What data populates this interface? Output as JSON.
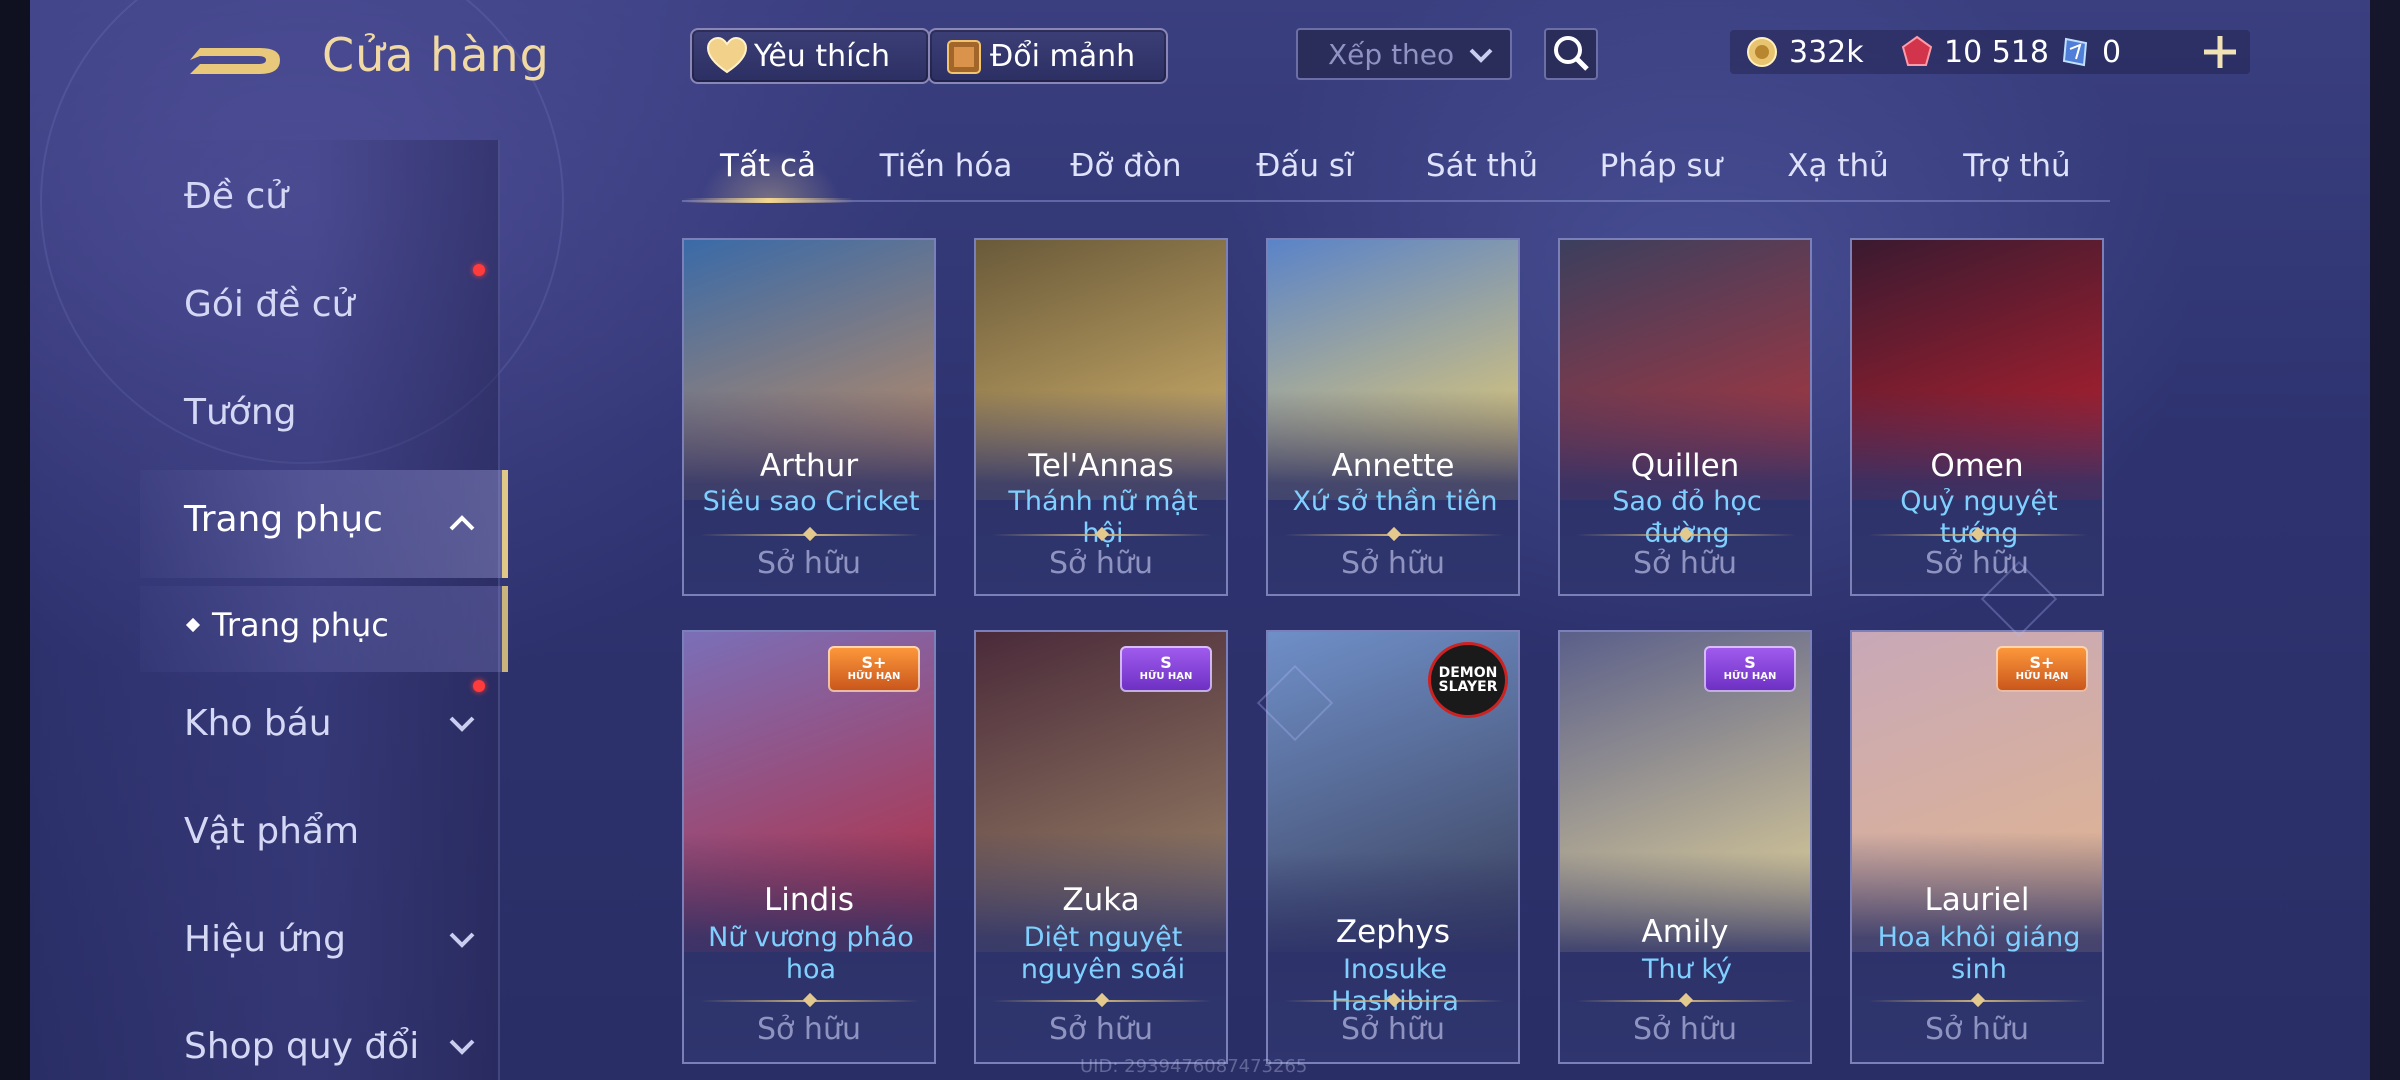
{
  "header": {
    "title": "Cửa hàng",
    "favorites_label": "Yêu thích",
    "shard_exchange_label": "Đổi mảnh",
    "sort_placeholder": "Xếp theo",
    "currencies": [
      {
        "icon": "gold-coin-icon",
        "value": "332k"
      },
      {
        "icon": "red-gem-icon",
        "value": "10 518"
      },
      {
        "icon": "card-voucher-icon",
        "value": "0"
      }
    ]
  },
  "sidebar": {
    "items": [
      {
        "label": "Đề cử"
      },
      {
        "label": "Gói đề cử"
      },
      {
        "label": "Tướng"
      },
      {
        "label": "Trang phục"
      },
      {
        "label": "Trang phục"
      },
      {
        "label": "Kho báu"
      },
      {
        "label": "Vật phẩm"
      },
      {
        "label": "Hiệu ứng"
      },
      {
        "label": "Shop quy đổi"
      }
    ]
  },
  "tabs": [
    "Tất cả",
    "Tiến hóa",
    "Đỡ đòn",
    "Đấu sĩ",
    "Sát thủ",
    "Pháp sư",
    "Xạ thủ",
    "Trợ thủ"
  ],
  "active_tab": "Tất cả",
  "cards": [
    {
      "hero": "Arthur",
      "skin": "Siêu sao Cricket",
      "status": "Sở hữu",
      "colors": [
        "#3a6aa8",
        "#c98f5e"
      ]
    },
    {
      "hero": "Tel'Annas",
      "skin": "Thánh nữ mật hội",
      "status": "Sở hữu",
      "colors": [
        "#6a5a3a",
        "#d9b870"
      ]
    },
    {
      "hero": "Annette",
      "skin": "Xứ sở thần tiên",
      "status": "Sở hữu",
      "colors": [
        "#5a83c8",
        "#f3d36a"
      ]
    },
    {
      "hero": "Quillen",
      "skin": "Sao đỏ học đường",
      "status": "Sở hữu",
      "colors": [
        "#3b3f5e",
        "#b8353b"
      ]
    },
    {
      "hero": "Omen",
      "skin": "Quỷ nguyệt tướng",
      "status": "Sở hữu",
      "colors": [
        "#3a1a30",
        "#c2212e"
      ]
    },
    {
      "hero": "Lindis",
      "skin": "Nữ vương pháo hoa",
      "status": "Sở hữu",
      "badge": {
        "grade": "S+",
        "text": "HỮU HẠN"
      },
      "colors": [
        "#7a6fb8",
        "#b82a3a"
      ]
    },
    {
      "hero": "Zuka",
      "skin": "Diệt nguyệt nguyên soái",
      "status": "Sở hữu",
      "badge": {
        "grade": "S",
        "text": "HỮU HẠN"
      },
      "colors": [
        "#4a2a3a",
        "#a08a6a"
      ]
    },
    {
      "hero": "Zephys",
      "skin": "Inosuke Hashibira",
      "status": "Sở hữu",
      "collab": "DEMON SLAYER",
      "colors": [
        "#6f8fc8",
        "#3a3f5a"
      ]
    },
    {
      "hero": "Amily",
      "skin": "Thư ký",
      "status": "Sở hữu",
      "badge": {
        "grade": "S",
        "text": "HỮU HẠN"
      },
      "colors": [
        "#5a5f8a",
        "#e8d89a"
      ]
    },
    {
      "hero": "Lauriel",
      "skin": "Hoa khôi giáng sinh",
      "status": "Sở hữu",
      "badge": {
        "grade": "S+",
        "text": "HỮU HẠN"
      },
      "colors": [
        "#c8a8b8",
        "#e2b58c"
      ]
    }
  ],
  "footer": {
    "uid": "UID: 2939476087473265"
  }
}
